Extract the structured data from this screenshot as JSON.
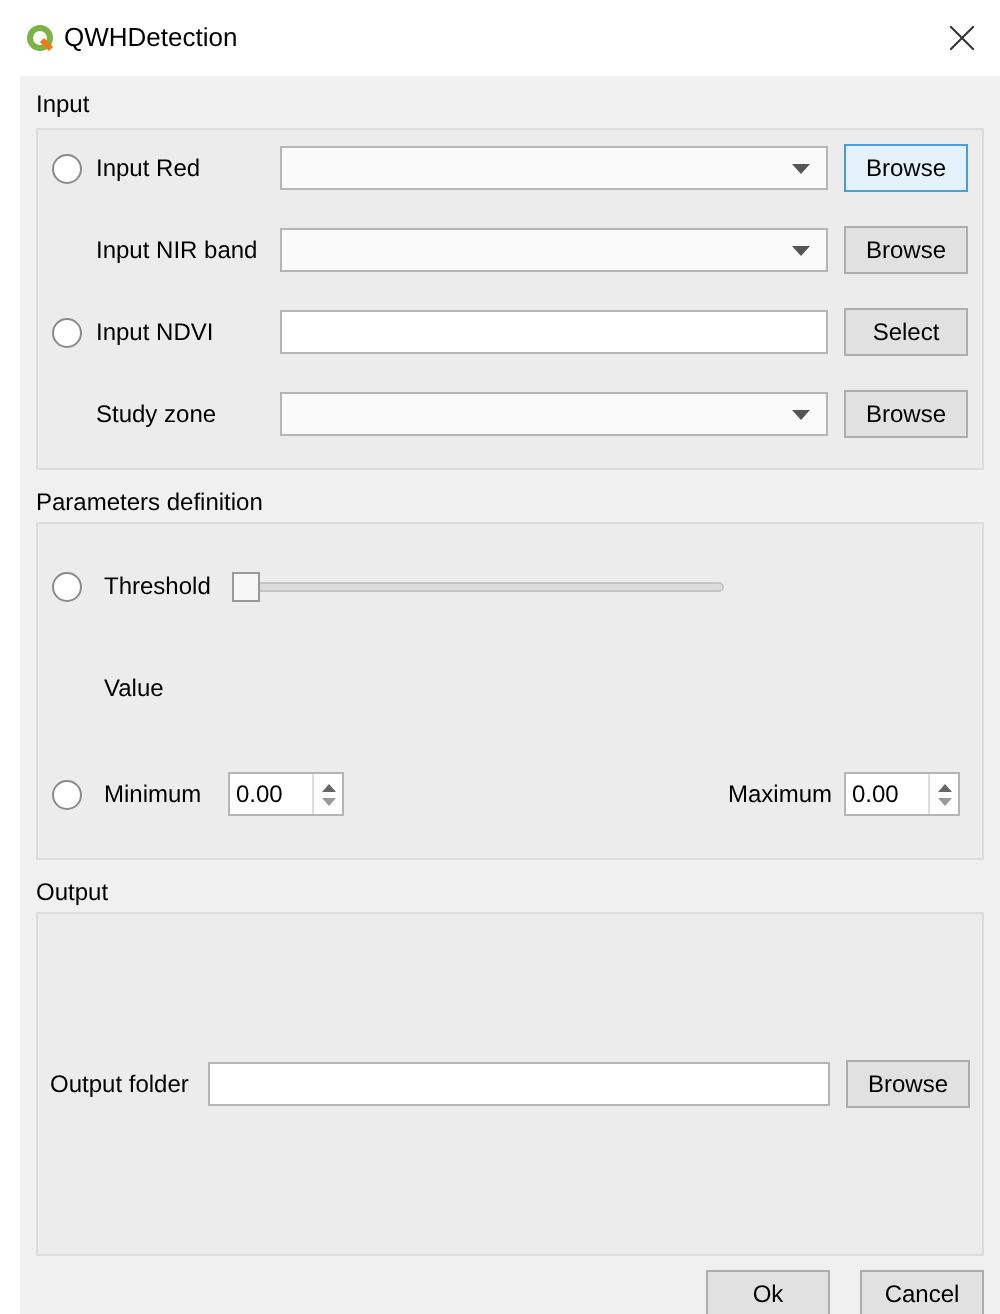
{
  "window": {
    "title": "QWHDetection"
  },
  "input": {
    "title": "Input",
    "rows": [
      {
        "kind": "radio-combo",
        "label": "Input Red",
        "checked": false,
        "button": {
          "label": "Browse",
          "focused": true
        }
      },
      {
        "kind": "combo",
        "label": "Input NIR band",
        "button": {
          "label": "Browse",
          "focused": false
        }
      },
      {
        "kind": "radio-text",
        "label": "Input NDVI",
        "checked": false,
        "button": {
          "label": "Select",
          "focused": false
        }
      },
      {
        "kind": "combo",
        "label": "Study zone",
        "button": {
          "label": "Browse",
          "focused": false
        }
      }
    ]
  },
  "parameters": {
    "title": "Parameters definition",
    "threshold": {
      "label": "Threshold",
      "checked": false,
      "level": 0
    },
    "value_label": "Value",
    "minimum": {
      "label": "Minimum",
      "checked": false,
      "value": "0.00"
    },
    "maximum": {
      "label": "Maximum",
      "value": "0.00"
    }
  },
  "output": {
    "title": "Output",
    "folder": {
      "label": "Output folder",
      "button": {
        "label": "Browse",
        "focused": false
      }
    }
  },
  "buttons": [
    {
      "label": "Ok"
    },
    {
      "label": "Cancel"
    }
  ]
}
